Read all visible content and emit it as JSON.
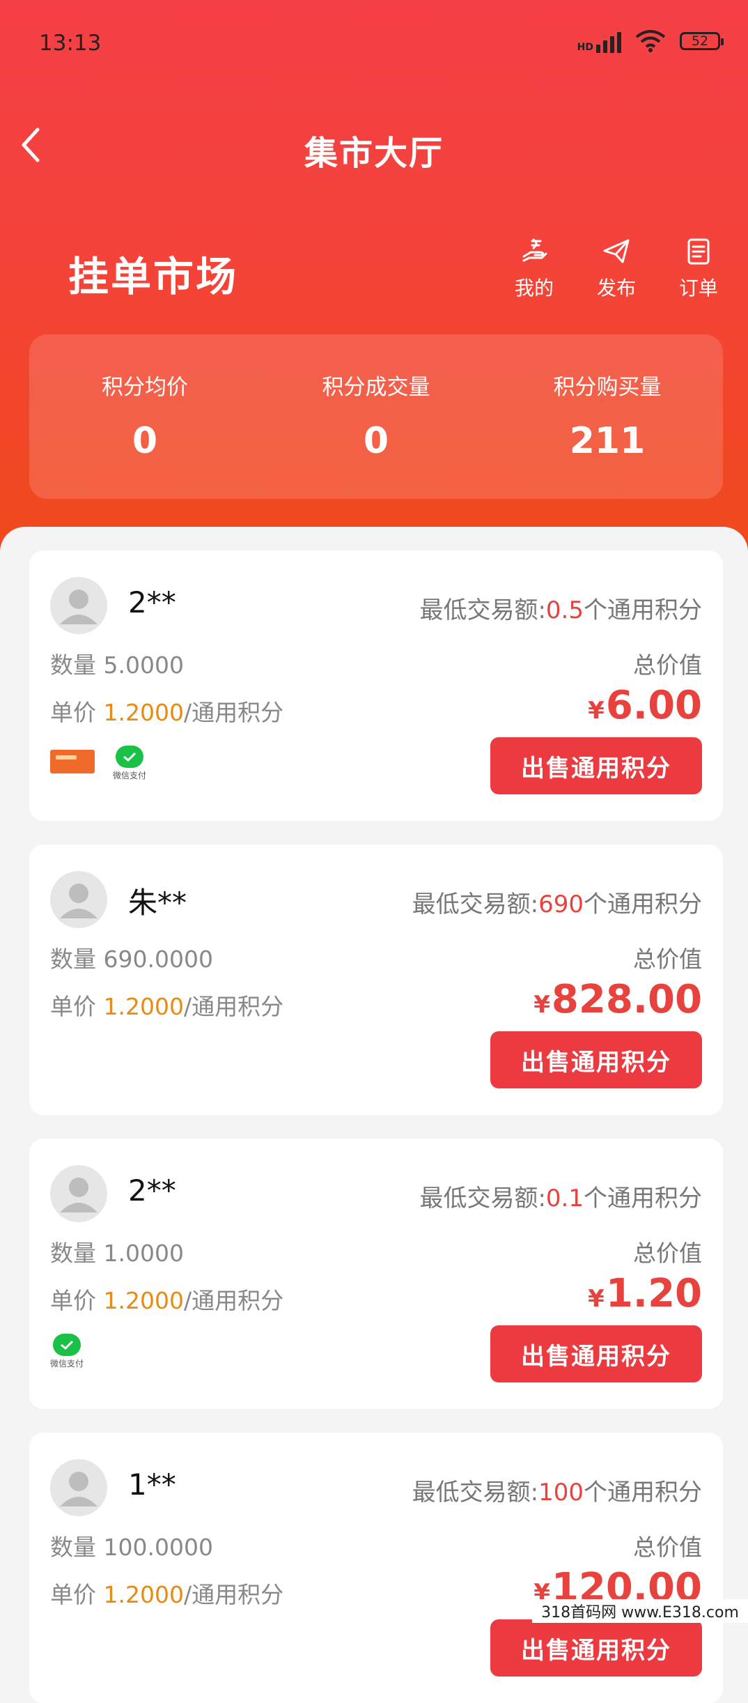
{
  "status_bar": {
    "time": "13:13",
    "network": "HD",
    "battery": "52"
  },
  "nav": {
    "title": "集市大厅"
  },
  "market": {
    "title": "挂单市场",
    "actions": [
      {
        "label": "我的",
        "icon": "hand-coin-icon"
      },
      {
        "label": "发布",
        "icon": "paper-plane-icon"
      },
      {
        "label": "订单",
        "icon": "document-list-icon"
      }
    ]
  },
  "stats": [
    {
      "label": "积分均价",
      "value": "0"
    },
    {
      "label": "积分成交量",
      "value": "0"
    },
    {
      "label": "积分购买量",
      "value": "211"
    }
  ],
  "labels": {
    "min_trade_prefix": "最低交易额:",
    "min_trade_suffix": "个通用积分",
    "qty_prefix": "数量",
    "unit_price_prefix": "单价",
    "unit_price_suffix": "/通用积分",
    "total_label": "总价值",
    "currency": "¥",
    "sell_button": "出售通用积分",
    "wechat_pay": "微信支付"
  },
  "listings": [
    {
      "user": "2**",
      "min_trade": "0.5",
      "qty": "5.0000",
      "unit_price": "1.2000",
      "total": "6.00",
      "payments": [
        "alipay-banner",
        "wechat"
      ]
    },
    {
      "user": "朱**",
      "min_trade": "690",
      "qty": "690.0000",
      "unit_price": "1.2000",
      "total": "828.00",
      "payments": []
    },
    {
      "user": "2**",
      "min_trade": "0.1",
      "qty": "1.0000",
      "unit_price": "1.2000",
      "total": "1.20",
      "payments": [
        "wechat"
      ]
    },
    {
      "user": "1**",
      "min_trade": "100",
      "qty": "100.0000",
      "unit_price": "1.2000",
      "total": "120.00",
      "payments": []
    }
  ],
  "watermark": "318首码网 www.E318.com",
  "colors": {
    "primary_red": "#ec3a41",
    "price_red": "#e8423e",
    "unit_orange": "#e88a13"
  }
}
